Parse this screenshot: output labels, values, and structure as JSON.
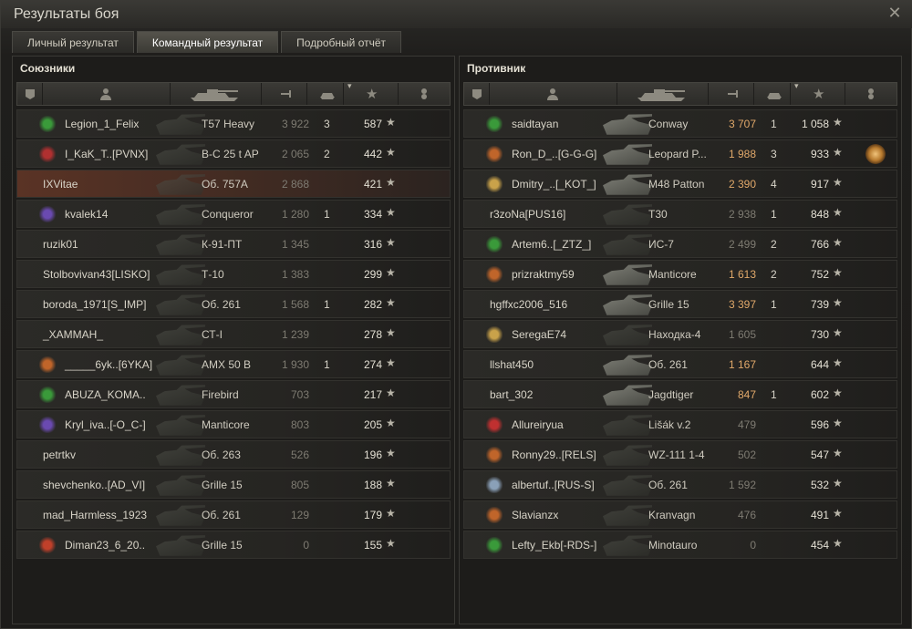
{
  "window": {
    "title": "Результаты боя"
  },
  "tabs": [
    {
      "label": "Личный результат",
      "active": false
    },
    {
      "label": "Командный результат",
      "active": true
    },
    {
      "label": "Подробный отчёт",
      "active": false
    }
  ],
  "allies": {
    "title": "Союзники",
    "rows": [
      {
        "player": "Legion_1_Felix",
        "vehicle": "T57 Heavy",
        "damage": "3 922",
        "kills": "3",
        "xp": "587",
        "badge": "#3a9a3a"
      },
      {
        "player": "I_KaK_T..[PVNX]",
        "vehicle": "B-C 25 t AP",
        "damage": "2 065",
        "kills": "2",
        "xp": "442",
        "badge": "#b03030"
      },
      {
        "player": "IXVitae",
        "vehicle": "Об. 757А",
        "damage": "2 868",
        "kills": "",
        "xp": "421",
        "badge": ""
      },
      {
        "player": "kvalek14",
        "vehicle": "Conqueror",
        "damage": "1 280",
        "kills": "1",
        "xp": "334",
        "badge": "#6a4ab0"
      },
      {
        "player": "ruzik01",
        "vehicle": "К-91-ПТ",
        "damage": "1 345",
        "kills": "",
        "xp": "316",
        "badge": ""
      },
      {
        "player": "Stolbovivan43[LISKO]",
        "vehicle": "Т-10",
        "damage": "1 383",
        "kills": "",
        "xp": "299",
        "badge": ""
      },
      {
        "player": "boroda_1971[S_IMP]",
        "vehicle": "Об. 261",
        "damage": "1 568",
        "kills": "1",
        "xp": "282",
        "badge": ""
      },
      {
        "player": "_XAMMAH_",
        "vehicle": "СТ-I",
        "damage": "1 239",
        "kills": "",
        "xp": "278",
        "badge": ""
      },
      {
        "player": "_____6yk..[6YKA]",
        "vehicle": "AMX 50 B",
        "damage": "1 930",
        "kills": "1",
        "xp": "274",
        "badge": "#c0652a"
      },
      {
        "player": "ABUZA_KOMA..",
        "vehicle": "Firebird",
        "damage": "703",
        "kills": "",
        "xp": "217",
        "badge": "#3a9a3a"
      },
      {
        "player": "Kryl_iva..[-O_C-]",
        "vehicle": "Manticore",
        "damage": "803",
        "kills": "",
        "xp": "205",
        "badge": "#6a4ab0"
      },
      {
        "player": "petrtkv",
        "vehicle": "Об. 263",
        "damage": "526",
        "kills": "",
        "xp": "196",
        "badge": ""
      },
      {
        "player": "shevchenko..[AD_VI]",
        "vehicle": "Grille 15",
        "damage": "805",
        "kills": "",
        "xp": "188",
        "badge": ""
      },
      {
        "player": "mad_Harmless_1923",
        "vehicle": "Об. 261",
        "damage": "129",
        "kills": "",
        "xp": "179",
        "badge": ""
      },
      {
        "player": "Diman23_6_20..",
        "vehicle": "Grille 15",
        "damage": "0",
        "kills": "",
        "xp": "155",
        "badge": "#c0402a"
      }
    ]
  },
  "enemies": {
    "title": "Противник",
    "rows": [
      {
        "player": "saidtayan",
        "vehicle": "Conway",
        "damage": "3 707",
        "kills": "1",
        "xp": "1 058",
        "badge": "#3a9a3a",
        "alive": true
      },
      {
        "player": "Ron_D_..[G-G-G]",
        "vehicle": "Leopard P...",
        "damage": "1 988",
        "kills": "3",
        "xp": "933",
        "badge": "#c0652a",
        "alive": true,
        "medal": true
      },
      {
        "player": "Dmitry_..[_KOT_]",
        "vehicle": "M48 Patton",
        "damage": "2 390",
        "kills": "4",
        "xp": "917",
        "badge": "#c9a24a",
        "alive": true
      },
      {
        "player": "r3zoNa[PUS16]",
        "vehicle": "T30",
        "damage": "2 938",
        "kills": "1",
        "xp": "848",
        "badge": ""
      },
      {
        "player": "Artem6..[_ZTZ_]",
        "vehicle": "ИС-7",
        "damage": "2 499",
        "kills": "2",
        "xp": "766",
        "badge": "#3a9a3a"
      },
      {
        "player": "prizraktmy59",
        "vehicle": "Manticore",
        "damage": "1 613",
        "kills": "2",
        "xp": "752",
        "badge": "#c0652a",
        "alive": true
      },
      {
        "player": "hgffxc2006_516",
        "vehicle": "Grille 15",
        "damage": "3 397",
        "kills": "1",
        "xp": "739",
        "badge": "",
        "alive": true
      },
      {
        "player": "SeregaE74",
        "vehicle": "Находка-4",
        "damage": "1 605",
        "kills": "",
        "xp": "730",
        "badge": "#c9a24a"
      },
      {
        "player": "llshat450",
        "vehicle": "Об. 261",
        "damage": "1 167",
        "kills": "",
        "xp": "644",
        "badge": "",
        "alive": true
      },
      {
        "player": "bart_302",
        "vehicle": "Jagdtiger",
        "damage": "847",
        "kills": "1",
        "xp": "602",
        "badge": "",
        "alive": true
      },
      {
        "player": "Allureiryua",
        "vehicle": "Lišák v.2",
        "damage": "479",
        "kills": "",
        "xp": "596",
        "badge": "#c03030"
      },
      {
        "player": "Ronny29..[RELS]",
        "vehicle": "WZ-111 1-4",
        "damage": "502",
        "kills": "",
        "xp": "547",
        "badge": "#c0652a"
      },
      {
        "player": "albertuf..[RUS-S]",
        "vehicle": "Об. 261",
        "damage": "1 592",
        "kills": "",
        "xp": "532",
        "badge": "#8aa0b8"
      },
      {
        "player": "Slavianzx",
        "vehicle": "Kranvagn",
        "damage": "476",
        "kills": "",
        "xp": "491",
        "badge": "#c0652a"
      },
      {
        "player": "Lefty_Ekb[-RDS-]",
        "vehicle": "Minotauro",
        "damage": "0",
        "kills": "",
        "xp": "454",
        "badge": "#3a9a3a"
      }
    ]
  }
}
